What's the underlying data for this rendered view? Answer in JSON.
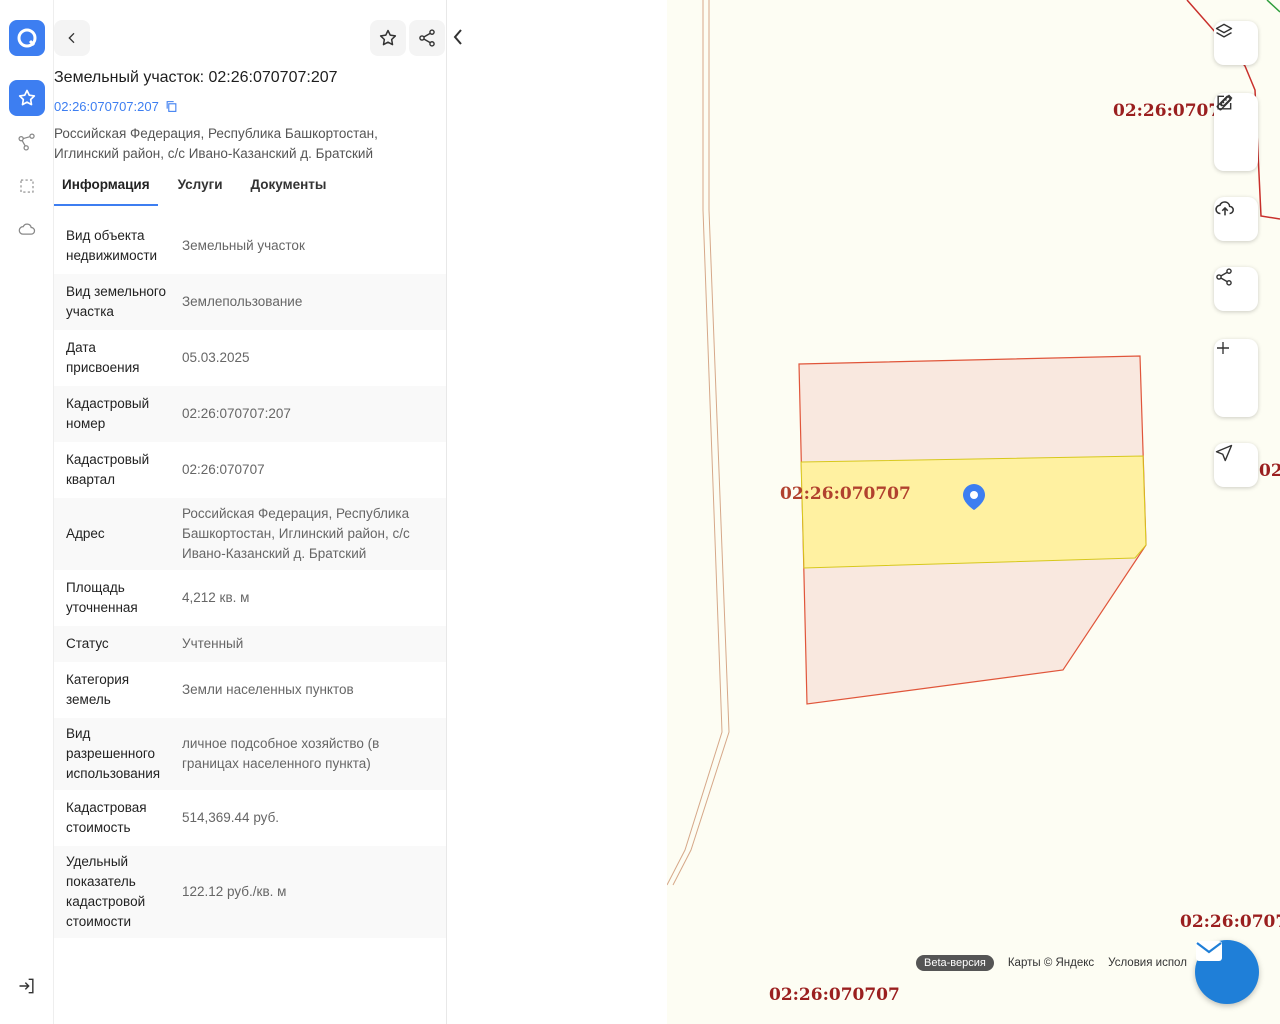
{
  "header": {
    "title": "Земельный участок: 02:26:070707:207",
    "cadastral_link": "02:26:070707:207",
    "address": "Российская Федерация, Республика Башкортостан, Иглинский район, с/с Ивано-Казанский д. Братский"
  },
  "tabs": [
    {
      "label": "Информация",
      "active": true
    },
    {
      "label": "Услуги",
      "active": false
    },
    {
      "label": "Документы",
      "active": false
    }
  ],
  "info_rows": [
    {
      "key": "Вид объекта недвижимости",
      "value": "Земельный участок"
    },
    {
      "key": "Вид земельного участка",
      "value": "Землепользование"
    },
    {
      "key": "Дата присвоения",
      "value": "05.03.2025"
    },
    {
      "key": "Кадастровый номер",
      "value": "02:26:070707:207"
    },
    {
      "key": "Кадастровый квартал",
      "value": "02:26:070707"
    },
    {
      "key": "Адрес",
      "value": "Российская Федерация, Республика Башкортостан, Иглинский район, с/с Ивано-Казанский д. Братский"
    },
    {
      "key": "Площадь уточненная",
      "value": "4,212 кв. м"
    },
    {
      "key": "Статус",
      "value": "Учтенный"
    },
    {
      "key": "Категория земель",
      "value": "Земли населенных пунктов"
    },
    {
      "key": "Вид разрешенного использования",
      "value": "личное подсобное хозяйство (в границах населенного пункта)"
    },
    {
      "key": "Кадастровая стоимость",
      "value": "514,369.44 руб."
    },
    {
      "key": "Удельный показатель кадастровой стоимости",
      "value": "122.12 руб./кв. м"
    }
  ],
  "map": {
    "labels": {
      "top_right": "02:26:0707",
      "parcel": "02:26:070707",
      "right_edge": "02:",
      "bottom_right": "02:26:0707",
      "bottom": "02:26:070707"
    },
    "footer": {
      "beta": "Beta-версия",
      "copyright": "Карты © Яндекс",
      "terms": "Условия испол"
    }
  },
  "colors": {
    "accent": "#3d7ef1",
    "parcel_border": "#e0553a",
    "parcel_fill": "#f9e8df",
    "highlight_fill": "#fff29a",
    "label_red": "#9a1f1f"
  }
}
